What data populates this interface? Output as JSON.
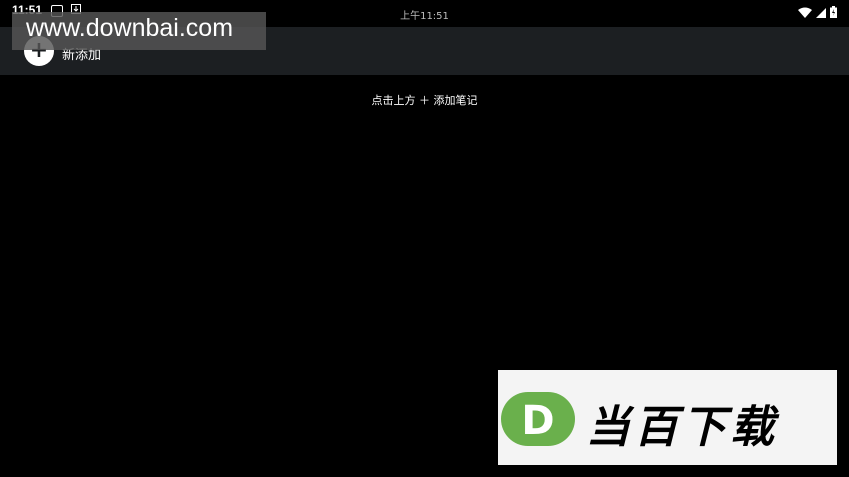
{
  "status_bar": {
    "time_left": "11:51",
    "time_center": "上午11:51"
  },
  "toolbar": {
    "add_icon_glyph": "+",
    "add_label": "新添加"
  },
  "main": {
    "empty_hint": "点击上方 ＋ 添加笔记"
  },
  "watermark_top": {
    "text": "www.downbai.com"
  },
  "watermark_bottom": {
    "logo_letter": "D",
    "text": "当百下载",
    "logo_color": "#6ab04c"
  },
  "icons": [
    "notification-icon",
    "downloads-icon",
    "wifi-icon",
    "cellular-signal-icon",
    "battery-icon",
    "add-icon"
  ]
}
